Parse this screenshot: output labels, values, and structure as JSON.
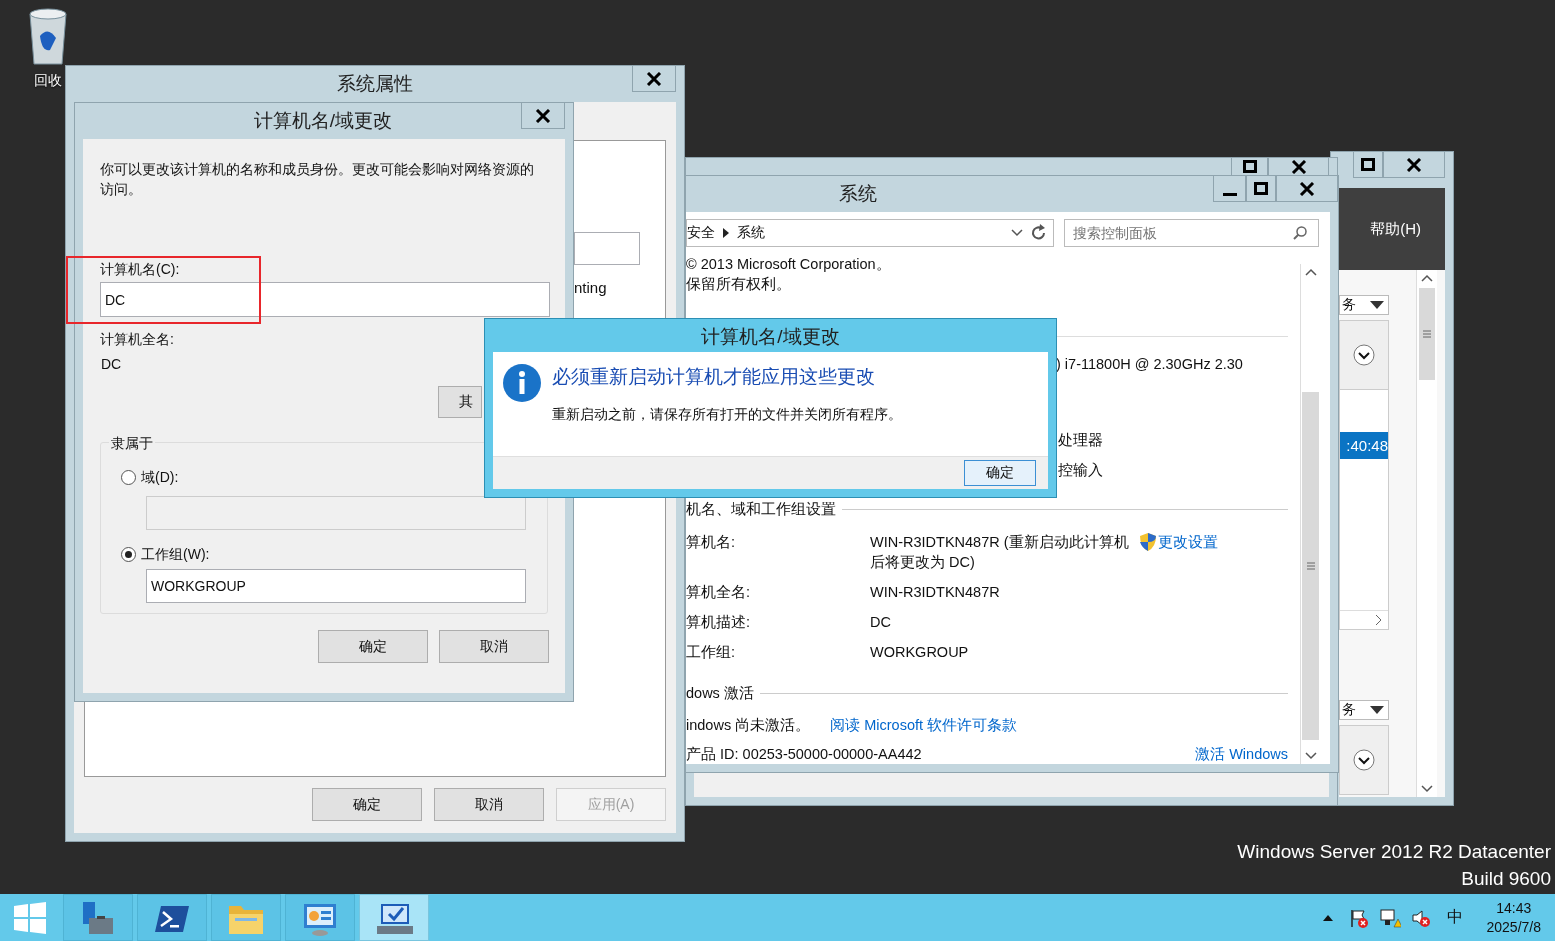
{
  "desktop": {
    "icons": [
      {
        "label": "回收"
      }
    ],
    "edition_lines": [
      "Windows Server 2012 R2 Datacenter",
      "Build 9600"
    ]
  },
  "server_manager": {
    "menu": [
      "帮助(H)"
    ],
    "dropdowns": [
      "务",
      "务"
    ],
    "rows": [
      {
        "text": ":40:48",
        "selected": true
      }
    ]
  },
  "system_window": {
    "title": "系统",
    "breadcrumb": [
      "安全",
      "系统"
    ],
    "search": {
      "placeholder": "搜索控制面板"
    },
    "copyright": [
      "© 2013 Microsoft Corporation。",
      "保留所有权利。"
    ],
    "processor": ") i7-11800H @ 2.30GHz   2.30",
    "system_lines": [
      "处理器",
      "控输入"
    ],
    "name_section": {
      "heading": "机名、域和工作组设置",
      "rows": [
        {
          "label": "算机名:",
          "value": "WIN-R3IDTKN487R (重新启动此计算机后将更改为 DC)"
        },
        {
          "label": "算机全名:",
          "value": "WIN-R3IDTKN487R"
        },
        {
          "label": "算机描述:",
          "value": "DC"
        },
        {
          "label": "工作组:",
          "value": "WORKGROUP"
        }
      ],
      "link": "更改设置"
    },
    "activation": {
      "heading": "dows 激活",
      "status": "indows 尚未激活。",
      "license_link": "阅读 Microsoft 软件许可条款",
      "product_id": "产品 ID: 00253-50000-00000-AA442",
      "activate_link": "激活 Windows"
    }
  },
  "system_properties": {
    "title": "系统属性",
    "panel_text": "nting",
    "buttons": [
      {
        "label": "确定",
        "disabled": false
      },
      {
        "label": "取消",
        "disabled": false
      },
      {
        "label": "应用(A)",
        "disabled": true
      }
    ]
  },
  "name_dialog": {
    "title": "计算机名/域更改",
    "description": "你可以更改该计算机的名称和成员身份。更改可能会影响对网络资源的访问。",
    "name_label": "计算机名(C):",
    "name_value": "DC",
    "full_name_label": "计算机全名:",
    "full_name": "DC",
    "more_button": "其",
    "member_of": {
      "legend": "隶属于",
      "options": [
        {
          "label": "域(D):",
          "selected": false
        },
        {
          "label": "工作组(W):",
          "selected": true,
          "value": "WORKGROUP"
        }
      ]
    },
    "buttons": [
      "确定",
      "取消"
    ]
  },
  "message_box": {
    "title": "计算机名/域更改",
    "heading": "必须重新启动计算机才能应用这些更改",
    "body": "重新启动之前，请保存所有打开的文件并关闭所有程序。",
    "button": "确定"
  },
  "taskbar": {
    "pinned": [
      {
        "kind": "server-manager",
        "selected": false
      },
      {
        "kind": "powershell",
        "selected": false
      },
      {
        "kind": "explorer",
        "selected": false
      },
      {
        "kind": "control-panel",
        "selected": false
      },
      {
        "kind": "system",
        "selected": true
      }
    ],
    "language": "中",
    "time": "14:43",
    "date": "2025/7/8"
  }
}
